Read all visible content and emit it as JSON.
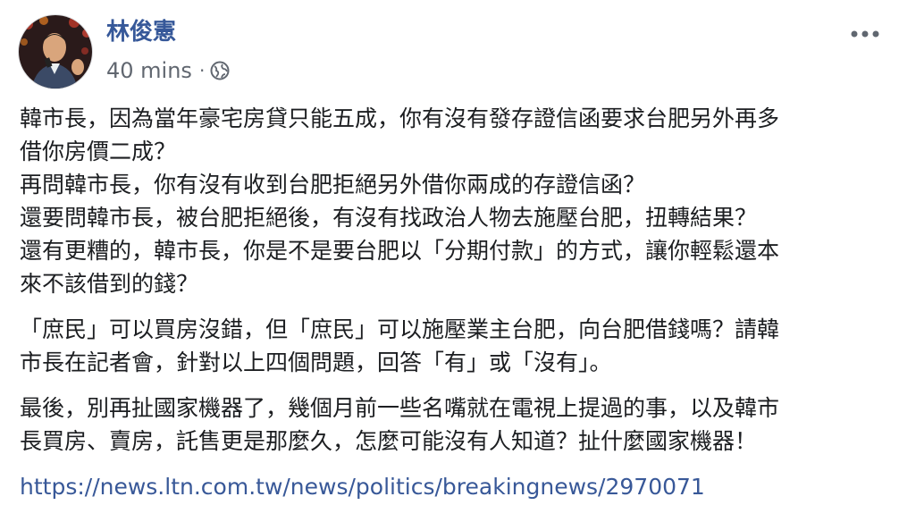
{
  "author": {
    "name": "林俊憲"
  },
  "post": {
    "timestamp": "40 mins",
    "separator": "·",
    "privacy_icon": "globe-icon",
    "more_icon": "ellipsis-icon",
    "lines_p1": [
      "韓市長，因為當年豪宅房貸只能五成，你有沒有發存證信函要求台肥另外再多",
      "借你房價二成？",
      "再問韓市長，你有沒有收到台肥拒絕另外借你兩成的存證信函？",
      "還要問韓市長，被台肥拒絕後，有沒有找政治人物去施壓台肥，扭轉結果？",
      "還有更糟的，韓市長，你是不是要台肥以「分期付款」的方式，讓你輕鬆還本",
      "來不該借到的錢？"
    ],
    "lines_p2": [
      "「庶民」可以買房沒錯，但「庶民」可以施壓業主台肥，向台肥借錢嗎？請韓",
      "市長在記者會，針對以上四個問題，回答「有」或「沒有」。"
    ],
    "lines_p3": [
      "最後，別再扯國家機器了，幾個月前一些名嘴就在電視上提過的事，以及韓市",
      "長買房、賣房，託售更是那麼久，怎麼可能沒有人知道？扯什麼國家機器！"
    ],
    "link": "https://news.ltn.com.tw/news/politics/breakingnews/2970071"
  },
  "colors": {
    "author": "#365899",
    "meta": "#616770",
    "text": "#1c1e21",
    "link": "#385898"
  }
}
